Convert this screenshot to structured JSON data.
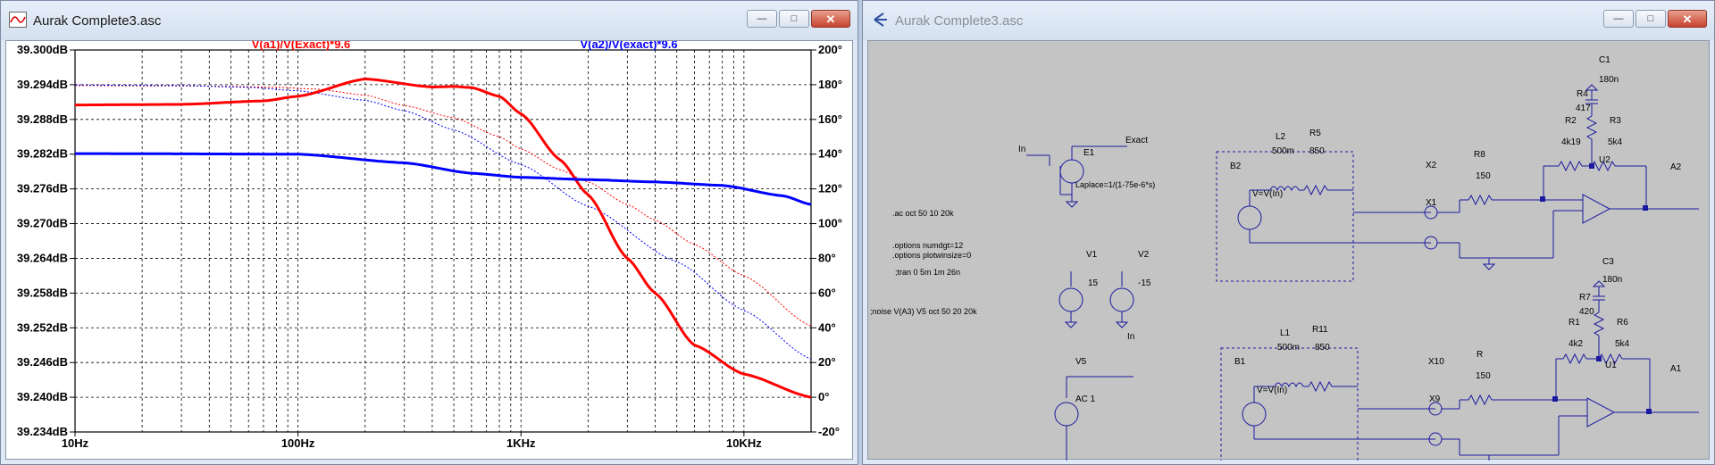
{
  "window_left": {
    "title": "Aurak Complete3.asc",
    "icon": "waveform-icon",
    "controls": [
      "minimize",
      "maximize",
      "close"
    ]
  },
  "window_right": {
    "title": "Aurak Complete3.asc",
    "icon": "schematic-icon",
    "controls": [
      "minimize",
      "maximize",
      "close"
    ]
  },
  "chart_data": {
    "type": "line",
    "x_scale": "log",
    "x_range": [
      10,
      20000
    ],
    "x_ticks": [
      {
        "value": 10,
        "label": "10Hz"
      },
      {
        "value": 100,
        "label": "100Hz"
      },
      {
        "value": 1000,
        "label": "1KHz"
      },
      {
        "value": 10000,
        "label": "10KHz"
      }
    ],
    "y_left": {
      "range": [
        39.234,
        39.3
      ],
      "ticks": [
        "39.300dB",
        "39.294dB",
        "39.288dB",
        "39.282dB",
        "39.276dB",
        "39.270dB",
        "39.264dB",
        "39.258dB",
        "39.252dB",
        "39.246dB",
        "39.240dB",
        "39.234dB"
      ]
    },
    "y_right": {
      "range": [
        -20,
        200
      ],
      "ticks": [
        "200°",
        "180°",
        "160°",
        "140°",
        "120°",
        "100°",
        "80°",
        "60°",
        "40°",
        "20°",
        "0°",
        "-20°"
      ]
    },
    "grid": true,
    "series": [
      {
        "name": "V(a1)/V(Exact)*9.6",
        "color": "#ff0000",
        "magnitude": {
          "x": [
            10,
            30,
            70,
            100,
            200,
            400,
            500,
            600,
            800,
            1000,
            1500,
            2000,
            3000,
            4000,
            6000,
            10000,
            20000
          ],
          "y": [
            39.2905,
            39.2906,
            39.2912,
            39.292,
            39.295,
            39.2936,
            39.2937,
            39.2935,
            39.292,
            39.289,
            39.281,
            39.275,
            39.264,
            39.258,
            39.249,
            39.244,
            39.24
          ]
        },
        "phase": {
          "x": [
            10,
            40,
            80,
            120,
            200,
            300,
            500,
            800,
            1000,
            1500,
            2000,
            3000,
            4000,
            6000,
            10000,
            20000
          ],
          "y": [
            179.5,
            179.2,
            178.5,
            177.5,
            174,
            168,
            161,
            150,
            143,
            131,
            124,
            111,
            102,
            88,
            70,
            41
          ]
        }
      },
      {
        "name": "V(a2)/V(exact)*9.6",
        "color": "#0000ff",
        "magnitude": {
          "x": [
            10,
            100,
            300,
            600,
            1000,
            2000,
            4000,
            8000,
            15000,
            20000
          ],
          "y": [
            39.2821,
            39.282,
            39.2805,
            39.2787,
            39.278,
            39.2776,
            39.2772,
            39.2766,
            39.2748,
            39.2733
          ]
        },
        "phase": {
          "x": [
            10,
            30,
            60,
            100,
            200,
            300,
            500,
            1000,
            2000,
            5000,
            10000,
            20000
          ],
          "y": [
            179.8,
            179.5,
            178.5,
            176.5,
            171,
            165,
            154,
            134,
            110,
            78,
            50,
            22
          ]
        }
      }
    ]
  },
  "schematic": {
    "labels": {
      "in1": "In",
      "exact": "Exact",
      "e1": "E1",
      "laplace": "Laplace=1/(1-75e-6*s)",
      "ac_cmd": ".ac oct 50 10 20k",
      "opt1": ".options numdgt=12",
      "opt2": ".options plotwinsize=0",
      "tran": ";tran 0 5m 1m 26n",
      "noise": ";noise V(A3) V5 oct 50 20 20k",
      "v1": "V1",
      "v1v": "15",
      "v2": "V2",
      "v2v": "-15",
      "v5": "V5",
      "v5v": "AC 1",
      "in2": "In",
      "b2": "B2",
      "b2v": "V=V(In)",
      "l2": "L2",
      "l2v": "500m",
      "r5": "R5",
      "r5v": "850",
      "b1": "B1",
      "b1v": "V=V(In)",
      "l1": "L1",
      "l1v": "500m",
      "r11": "R11",
      "r11v": "850",
      "x2": "X2",
      "x1": "X1",
      "x10": "X10",
      "x9": "X9",
      "r8": "R8",
      "r8v": "150",
      "r": "R",
      "rv": "150",
      "c1": "C1",
      "c1v": "180n",
      "r4": "R4",
      "r4v": "417",
      "r2": "R2",
      "r2v": "4k19",
      "r3": "R3",
      "r3v": "5k4",
      "u2": "U2",
      "a2": "A2",
      "c3": "C3",
      "c3v": "180n",
      "r7": "R7",
      "r7v": "420",
      "r1": "R1",
      "r1v": "4k2",
      "r6": "R6",
      "r6v": "5k4",
      "u1": "U1",
      "a1": "A1"
    }
  }
}
